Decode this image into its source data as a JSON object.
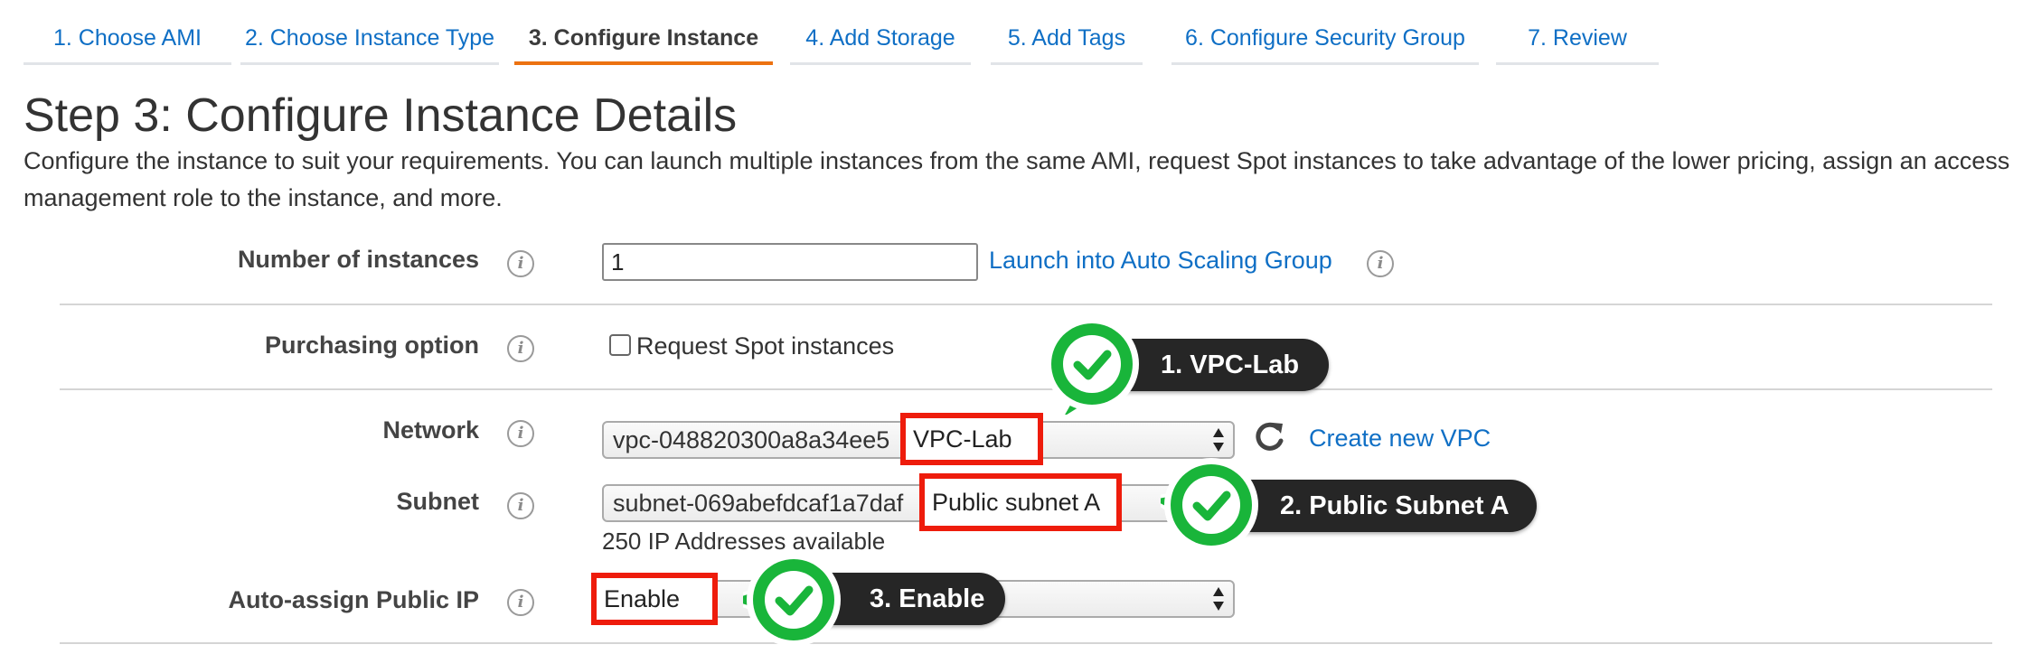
{
  "tabs": [
    {
      "label": "1. Choose AMI"
    },
    {
      "label": "2. Choose Instance Type"
    },
    {
      "label": "3. Configure Instance"
    },
    {
      "label": "4. Add Storage"
    },
    {
      "label": "5. Add Tags"
    },
    {
      "label": "6. Configure Security Group"
    },
    {
      "label": "7. Review"
    }
  ],
  "active_tab": "3. Configure Instance",
  "page": {
    "title": "Step 3: Configure Instance Details",
    "description": "Configure the instance to suit your requirements. You can launch multiple instances from the same AMI, request Spot instances to take advantage of the lower pricing, assign an access management role to the instance, and more."
  },
  "form": {
    "number_of_instances": {
      "label": "Number of instances",
      "value": "1",
      "link": "Launch into Auto Scaling Group"
    },
    "purchasing_option": {
      "label": "Purchasing option",
      "checkbox_label": "Request Spot instances",
      "checked": false
    },
    "network": {
      "label": "Network",
      "value_id": "vpc-048820300a8a34ee5",
      "value_name": "VPC-Lab",
      "create_link": "Create new VPC"
    },
    "subnet": {
      "label": "Subnet",
      "value_id": "subnet-069abefdcaf1a7daf",
      "value_name": "Public subnet A",
      "available": "250 IP Addresses available"
    },
    "auto_assign_public_ip": {
      "label": "Auto-assign Public IP",
      "value": "Enable"
    }
  },
  "icons": {
    "info": "i",
    "info_icon": "info-icon",
    "refresh_icon": "refresh-icon",
    "check_icon": "check-icon",
    "select_arrows_icon": "select-arrows-icon"
  },
  "callouts": [
    {
      "label": "1. VPC-Lab"
    },
    {
      "label": "2. Public Subnet A"
    },
    {
      "label": "3. Enable"
    }
  ],
  "colors": {
    "link": "#0f6fc5",
    "active_tab_underline": "#ec7211",
    "highlight_red": "#ee1c0c",
    "check_green": "#19b53a",
    "callout_bg": "#262626"
  }
}
